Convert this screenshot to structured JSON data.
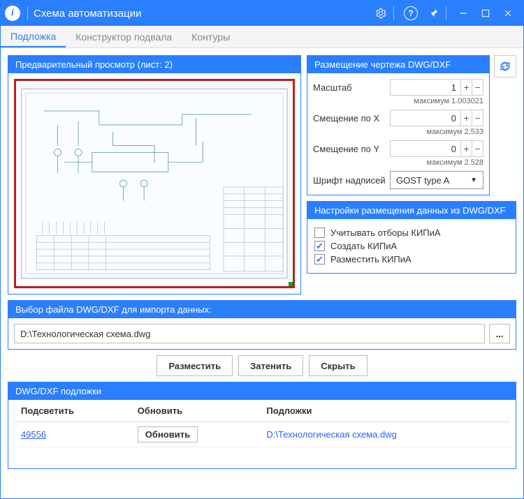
{
  "titlebar": {
    "title": "Схема автоматизации"
  },
  "tabs": {
    "t0": "Подложка",
    "t1": "Конструктор подвала",
    "t2": "Контуры"
  },
  "preview": {
    "head": "Предварительный просмотр (лист: 2)"
  },
  "placement": {
    "head": "Размещение чертежа DWG/DXF",
    "scale_lbl": "Масштаб",
    "scale_val": "1",
    "scale_max": "максимум 1.003021",
    "offx_lbl": "Смещение по X",
    "offx_val": "0",
    "offx_max": "максимум 2.533",
    "offy_lbl": "Смещение по Y",
    "offy_val": "0",
    "offy_max": "максимум 2.528",
    "font_lbl": "Шрифт надписей",
    "font_val": "GOST type A"
  },
  "settings": {
    "head": "Настройки размещения данных из DWG/DXF",
    "c0": "Учитывать отборы КИПиА",
    "c1": "Создать КИПиА",
    "c2": "Разместить КИПиА"
  },
  "file": {
    "head": "Выбор файла DWG/DXF для импорта данных:",
    "path": "D:\\Технологическая схема.dwg",
    "browse": "..."
  },
  "actions": {
    "place": "Разместить",
    "shade": "Затенить",
    "hide": "Скрыть"
  },
  "grid": {
    "head": "DWG/DXF подложки",
    "h0": "Подсветить",
    "h1": "Обновить",
    "h2": "Подложки",
    "row": {
      "id": "49556",
      "upd": "Обновить",
      "path": "D:\\Технологическая схема.dwg"
    }
  }
}
